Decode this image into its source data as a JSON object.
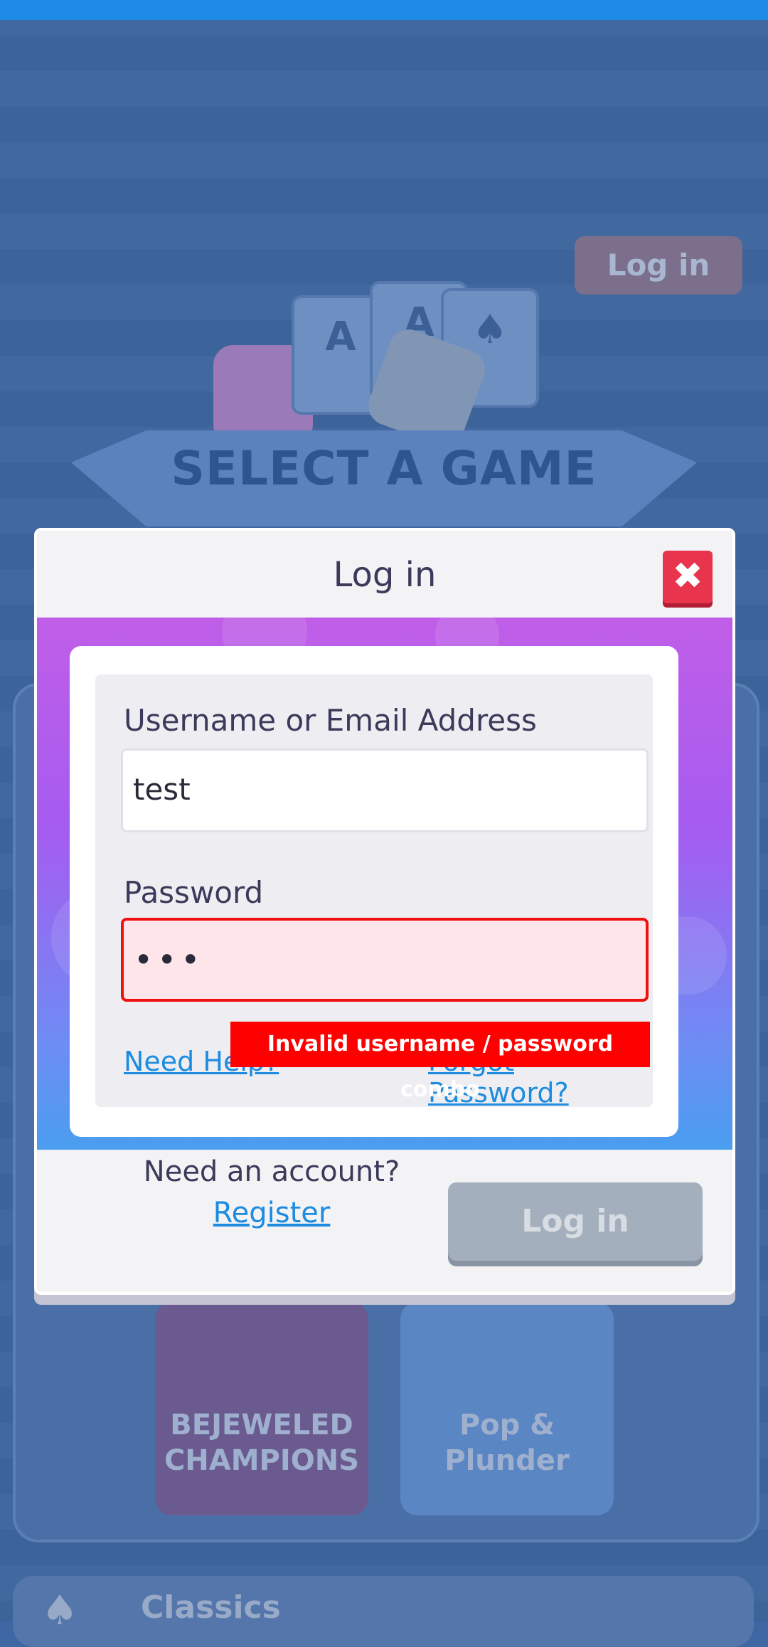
{
  "background": {
    "header_login_label": "Log in",
    "title": "SELECT A GAME",
    "cards": [
      "A",
      "A",
      "♠"
    ],
    "games": [
      {
        "name_line1": "BEJEWELED",
        "name_line2": "CHAMPIONS"
      },
      {
        "name_line1": "Pop &",
        "name_line2": "Plunder"
      }
    ],
    "classics_label": "Classics"
  },
  "modal": {
    "title": "Log in",
    "close_icon": "close-x-icon",
    "username_label": "Username or Email Address",
    "username_value": "test",
    "password_label": "Password",
    "password_value": "•••",
    "error_message": "Invalid username / password combo",
    "need_help_link": "Need Help?",
    "forgot_password_link": "Forgot Password?",
    "need_account_text": "Need an account?",
    "register_link": "Register",
    "login_button": "Log in"
  },
  "colors": {
    "close_button": "#e8344c",
    "error": "#ff0000",
    "link": "#1d8ce0",
    "gradient_top": "#c05ee8",
    "gradient_bottom": "#4a9ef0"
  }
}
